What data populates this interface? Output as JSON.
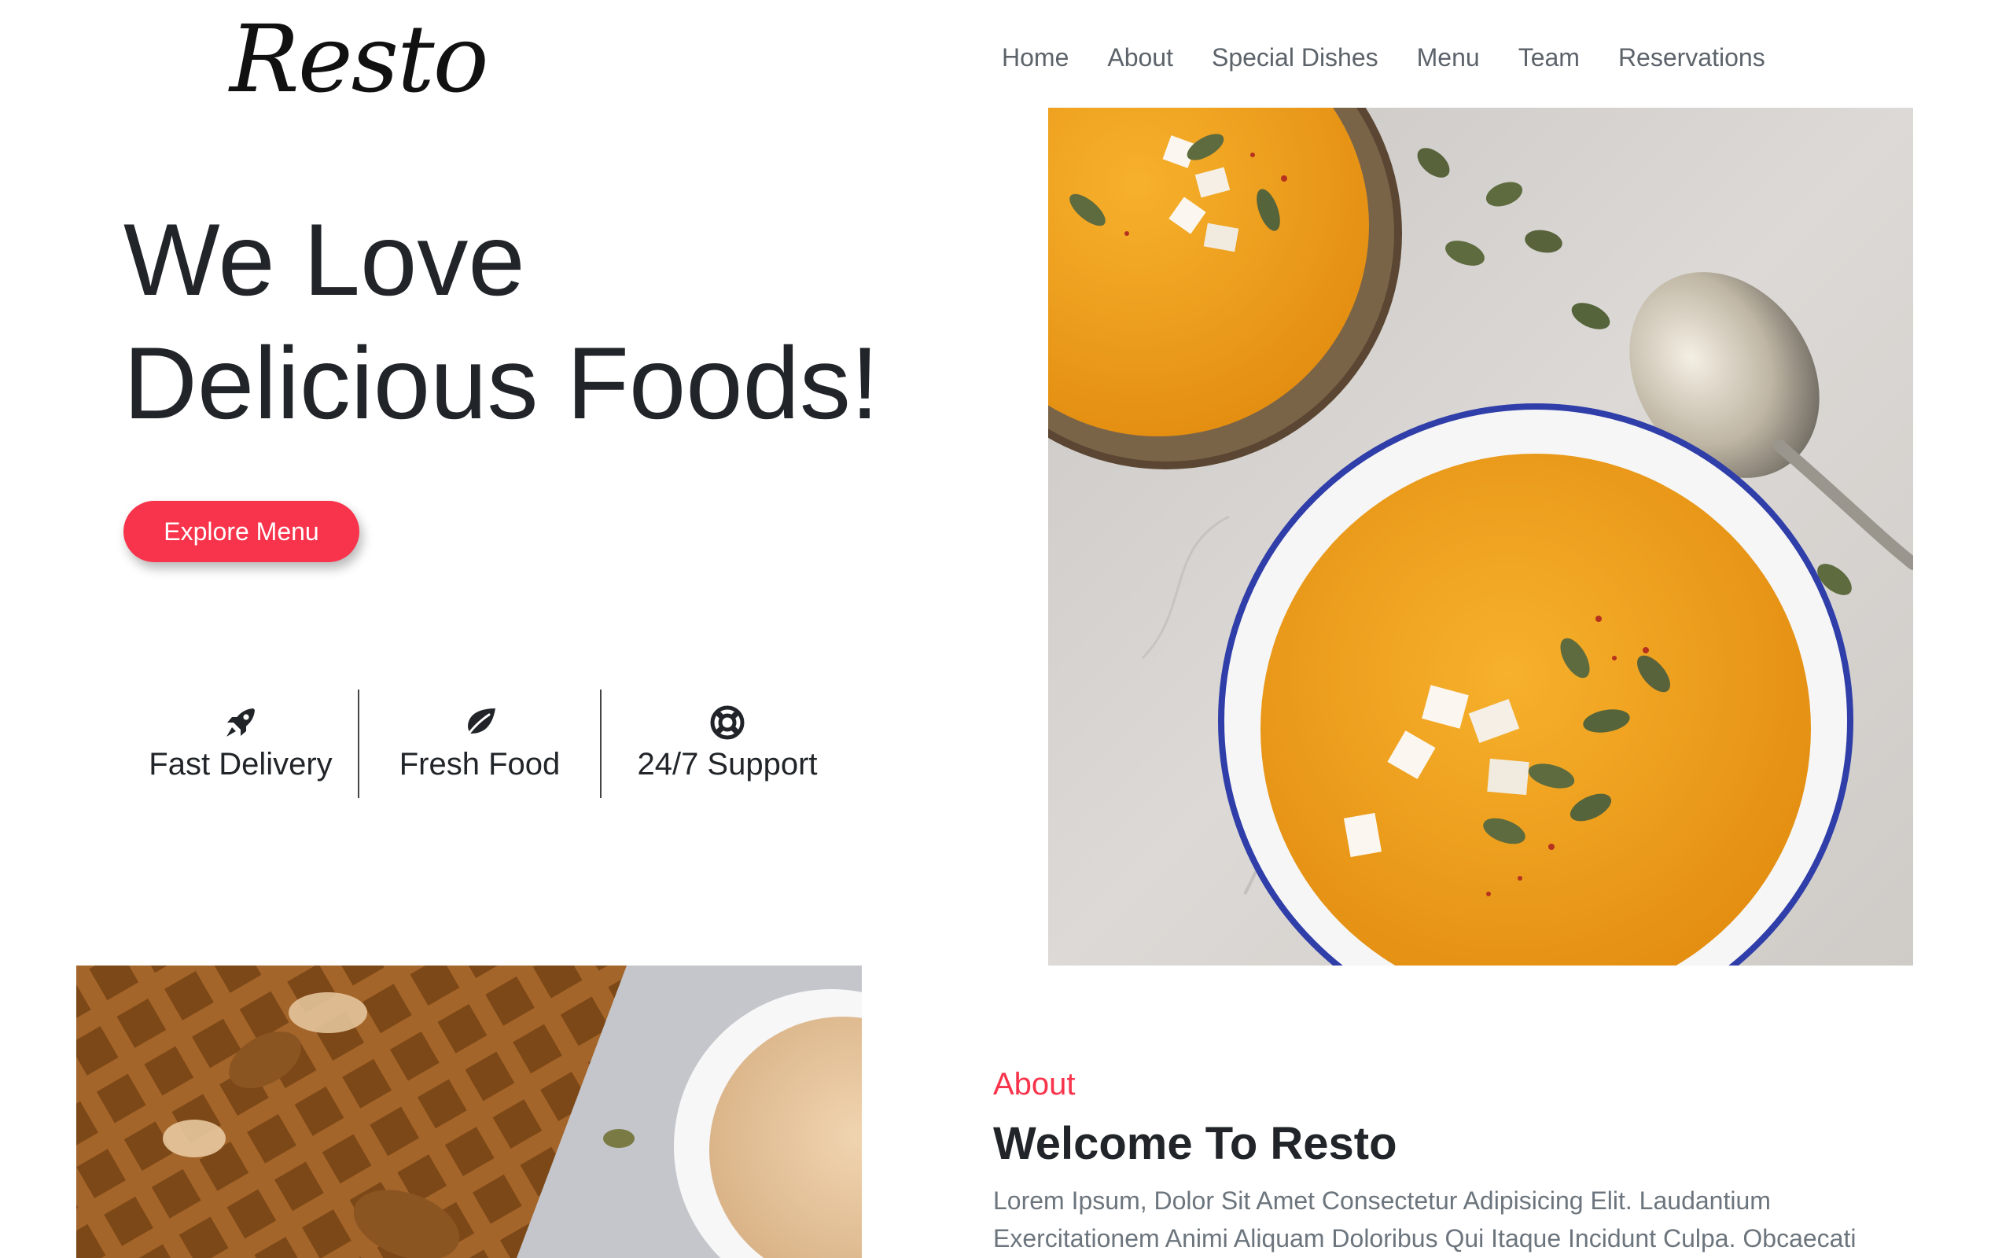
{
  "brand": {
    "logo_text": "Resto"
  },
  "nav": {
    "items": [
      {
        "label": "Home"
      },
      {
        "label": "About"
      },
      {
        "label": "Special Dishes"
      },
      {
        "label": "Menu"
      },
      {
        "label": "Team"
      },
      {
        "label": "Reservations"
      }
    ]
  },
  "hero": {
    "title_line1": "We Love",
    "title_line2": "Delicious Foods!",
    "cta_label": "Explore Menu",
    "image_name": "pumpkin-soup-bowls-photo"
  },
  "features": [
    {
      "icon": "rocket-icon",
      "label": "Fast Delivery"
    },
    {
      "icon": "leaf-icon",
      "label": "Fresh Food"
    },
    {
      "icon": "lifebuoy-icon",
      "label": "24/7 Support"
    }
  ],
  "carousel": {
    "prev_symbol": "❮",
    "next_symbol": "❯"
  },
  "about": {
    "image_name": "waffles-with-sauce-photo",
    "kicker": "About",
    "title": "Welcome To Resto",
    "text": "Lorem Ipsum, Dolor Sit Amet Consectetur Adipisicing Elit. Laudantium Exercitationem Animi Aliquam Doloribus Qui Itaque Incidunt Culpa. Obcaecati"
  },
  "colors": {
    "accent": "#f7344b",
    "heading": "#212529",
    "nav_text": "#5c636a",
    "muted_text": "#6c757d",
    "soup": "#f0a020",
    "table": "#d6d3d0"
  }
}
